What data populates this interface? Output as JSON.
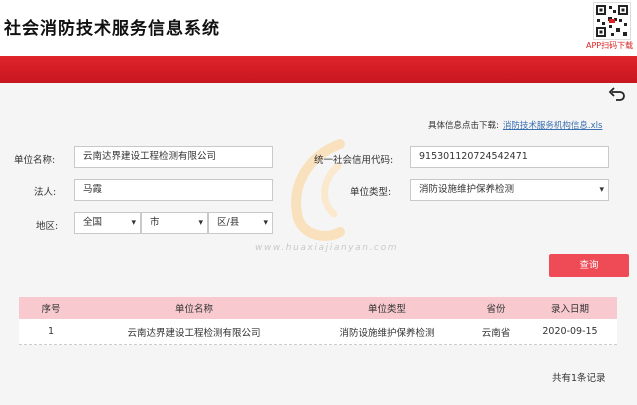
{
  "header": {
    "title": "社会消防技术服务信息系统",
    "qr_caption": "APP扫码下载"
  },
  "download": {
    "prefix": "具体信息点击下载:",
    "link_text": "消防技术服务机构信息.xls"
  },
  "form": {
    "unit_name_label": "单位名称:",
    "unit_name_value": "云南达界建设工程检测有限公司",
    "credit_code_label": "统一社会信用代码:",
    "credit_code_value": "915301120724542471",
    "legal_person_label": "法人:",
    "legal_person_value": "马霞",
    "unit_type_label": "单位类型:",
    "unit_type_value": "消防设施维护保养检测",
    "region_label": "地区:",
    "province_value": "全国",
    "city_value": "市",
    "district_value": "区/县",
    "query_button": "查询"
  },
  "table": {
    "columns": [
      "序号",
      "单位名称",
      "单位类型",
      "省份",
      "录入日期"
    ],
    "rows": [
      [
        "1",
        "云南达界建设工程检测有限公司",
        "消防设施维护保养检测",
        "云南省",
        "2020-09-15"
      ]
    ]
  },
  "footer": {
    "count_text": "共有1条记录"
  },
  "watermark": {
    "text": "www.huaxiajianyan.com"
  },
  "colors": {
    "brand_red": "#d91e26",
    "button_red": "#ef4b56",
    "table_header": "#f8c9ce",
    "link_blue": "#3a6fb0"
  }
}
